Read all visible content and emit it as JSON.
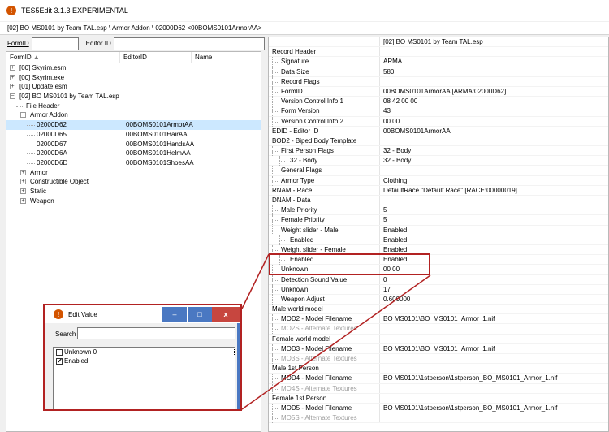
{
  "window": {
    "title": "TES5Edit 3.1.3 EXPERIMENTAL"
  },
  "path": "[02] BO MS0101 by Team TAL.esp \\ Armor Addon \\ 02000D62 <00BOMS0101ArmorAA>",
  "filter": {
    "formid_label": "FormID",
    "editorid_label": "Editor ID",
    "formid_value": "",
    "editorid_value": ""
  },
  "tree": {
    "columns": [
      "FormID",
      "EditorID",
      "Name"
    ],
    "sort_icon": "triangle-up-icon",
    "rows": [
      {
        "formid": "[00] Skyrim.esm",
        "editorid": ""
      },
      {
        "formid": "[00] Skyrim.exe",
        "editorid": ""
      },
      {
        "formid": "[01] Update.esm",
        "editorid": ""
      },
      {
        "formid": "[02] BO MS0101 by Team TAL.esp",
        "editorid": ""
      },
      {
        "formid": "File Header",
        "editorid": ""
      },
      {
        "formid": "Armor Addon",
        "editorid": ""
      },
      {
        "formid": "02000D62",
        "editorid": "00BOMS0101ArmorAA"
      },
      {
        "formid": "02000D65",
        "editorid": "00BOMS0101HairAA"
      },
      {
        "formid": "02000D67",
        "editorid": "00BOMS0101HandsAA"
      },
      {
        "formid": "02000D6A",
        "editorid": "00BOMS0101HelmAA"
      },
      {
        "formid": "02000D6D",
        "editorid": "00BOMS0101ShoesAA"
      },
      {
        "formid": "Armor",
        "editorid": ""
      },
      {
        "formid": "Constructible Object",
        "editorid": ""
      },
      {
        "formid": "Static",
        "editorid": ""
      },
      {
        "formid": "Weapon",
        "editorid": ""
      }
    ]
  },
  "record": {
    "file_header": "[02] BO MS0101 by Team TAL.esp",
    "rows": [
      {
        "label": "Record Header",
        "value": ""
      },
      {
        "label": "Signature",
        "value": "ARMA"
      },
      {
        "label": "Data Size",
        "value": "580"
      },
      {
        "label": "Record Flags",
        "value": ""
      },
      {
        "label": "FormID",
        "value": "00BOMS0101ArmorAA [ARMA:02000D62]"
      },
      {
        "label": "Version Control Info 1",
        "value": "08 42 00 00"
      },
      {
        "label": "Form Version",
        "value": "43"
      },
      {
        "label": "Version Control Info 2",
        "value": "00 00"
      },
      {
        "label": "EDID - Editor ID",
        "value": "00BOMS0101ArmorAA"
      },
      {
        "label": "BOD2 - Biped Body Template",
        "value": ""
      },
      {
        "label": "First Person Flags",
        "value": "32 - Body"
      },
      {
        "label": "32 - Body",
        "value": "32 - Body"
      },
      {
        "label": "General Flags",
        "value": ""
      },
      {
        "label": "Armor Type",
        "value": "Clothing"
      },
      {
        "label": "RNAM - Race",
        "value": "DefaultRace \"Default Race\" [RACE:00000019]"
      },
      {
        "label": "DNAM - Data",
        "value": ""
      },
      {
        "label": "Male Priority",
        "value": "5"
      },
      {
        "label": "Female Priority",
        "value": "5"
      },
      {
        "label": "Weight slider - Male",
        "value": "Enabled"
      },
      {
        "label": "Enabled",
        "value": "Enabled"
      },
      {
        "label": "Weight slider - Female",
        "value": "Enabled"
      },
      {
        "label": "Enabled",
        "value": "Enabled"
      },
      {
        "label": "Unknown",
        "value": "00 00"
      },
      {
        "label": "Detection Sound Value",
        "value": "0"
      },
      {
        "label": "Unknown",
        "value": "17"
      },
      {
        "label": "Weapon Adjust",
        "value": "0.600000"
      },
      {
        "label": "Male world model",
        "value": ""
      },
      {
        "label": "MOD2 - Model Filename",
        "value": "BO MS0101\\BO_MS0101_Armor_1.nif"
      },
      {
        "label": "MO2S - Alternate Textures",
        "value": ""
      },
      {
        "label": "Female world model",
        "value": ""
      },
      {
        "label": "MOD3 - Model Filename",
        "value": "BO MS0101\\BO_MS0101_Armor_1.nif"
      },
      {
        "label": "MO3S - Alternate Textures",
        "value": ""
      },
      {
        "label": "Male 1st Person",
        "value": ""
      },
      {
        "label": "MOD4 - Model Filename",
        "value": "BO MS0101\\1stperson\\1stperson_BO_MS0101_Armor_1.nif"
      },
      {
        "label": "MO4S - Alternate Textures",
        "value": ""
      },
      {
        "label": "Female 1st Person",
        "value": ""
      },
      {
        "label": "MOD5 - Model Filename",
        "value": "BO MS0101\\1stperson\\1stperson_BO_MS0101_Armor_1.nif"
      },
      {
        "label": "MO5S - Alternate Textures",
        "value": ""
      }
    ]
  },
  "dialog": {
    "title": "Edit Value",
    "search_label": "Search",
    "search_value": "",
    "items": [
      {
        "label": "Unknown 0",
        "checked": false
      },
      {
        "label": "Enabled",
        "checked": true
      }
    ],
    "min_glyph": "–",
    "max_glyph": "□",
    "close_glyph": "x"
  },
  "colors": {
    "highlight": "#b22222",
    "selection": "#cce8ff",
    "dialog_accent": "#4a78c2",
    "close": "#c7463f"
  }
}
